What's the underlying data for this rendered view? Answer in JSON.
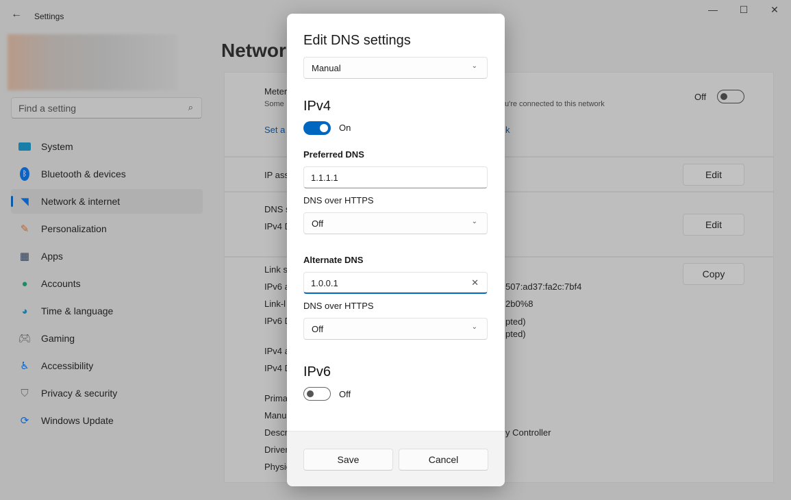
{
  "window": {
    "title": "Settings",
    "back_icon": "arrow-left-icon",
    "minimize_icon": "minimize-icon",
    "maximize_icon": "maximize-icon",
    "close_icon": "close-icon"
  },
  "sidebar": {
    "search_placeholder": "Find a setting",
    "items": [
      {
        "label": "System",
        "icon": "monitor-icon"
      },
      {
        "label": "Bluetooth & devices",
        "icon": "bluetooth-icon"
      },
      {
        "label": "Network & internet",
        "icon": "wifi-icon",
        "selected": true
      },
      {
        "label": "Personalization",
        "icon": "brush-icon"
      },
      {
        "label": "Apps",
        "icon": "apps-icon"
      },
      {
        "label": "Accounts",
        "icon": "person-icon"
      },
      {
        "label": "Time & language",
        "icon": "globe-clock-icon"
      },
      {
        "label": "Gaming",
        "icon": "gamepad-icon"
      },
      {
        "label": "Accessibility",
        "icon": "accessibility-icon"
      },
      {
        "label": "Privacy & security",
        "icon": "shield-icon"
      },
      {
        "label": "Windows Update",
        "icon": "update-icon"
      }
    ]
  },
  "main": {
    "title_partial": "Networ",
    "metered": {
      "label_partial": "Meter",
      "desc_partial_left": "Some",
      "desc_partial_right": "u're connected to this network",
      "toggle_label": "Off",
      "link_partial_left": "Set a",
      "link_partial_right": "k"
    },
    "ip_assignment": {
      "label_partial": "IP ass",
      "button": "Edit"
    },
    "dns": {
      "label_partial": "DNS s",
      "sub_partial": "IPv4 D",
      "button": "Edit"
    },
    "properties": {
      "button": "Copy",
      "rows_left": [
        "Link s",
        "IPv6 a",
        "Link-l",
        "IPv6 D",
        "",
        "IPv4 a",
        "IPv4 D",
        "",
        "Prima",
        "Manu",
        "Descr",
        "Driver",
        "Physic"
      ],
      "ipv6_addr_partial": "507:ad37:fa2c:7bf4",
      "link_local_partial": "2b0%8",
      "ipv6_dns_partial_1": "pted)",
      "ipv6_dns_partial_2": "pted)",
      "desc_partial": "y Controller"
    }
  },
  "dialog": {
    "title": "Edit DNS settings",
    "mode": "Manual",
    "ipv4": {
      "heading": "IPv4",
      "toggle": "On",
      "preferred_label": "Preferred DNS",
      "preferred_value": "1.1.1.1",
      "doh_label_1": "DNS over HTTPS",
      "doh_value_1": "Off",
      "alternate_label": "Alternate DNS",
      "alternate_value": "1.0.0.1",
      "doh_label_2": "DNS over HTTPS",
      "doh_value_2": "Off"
    },
    "ipv6": {
      "heading": "IPv6",
      "toggle": "Off"
    },
    "save": "Save",
    "cancel": "Cancel",
    "accent": "#0067c0"
  }
}
